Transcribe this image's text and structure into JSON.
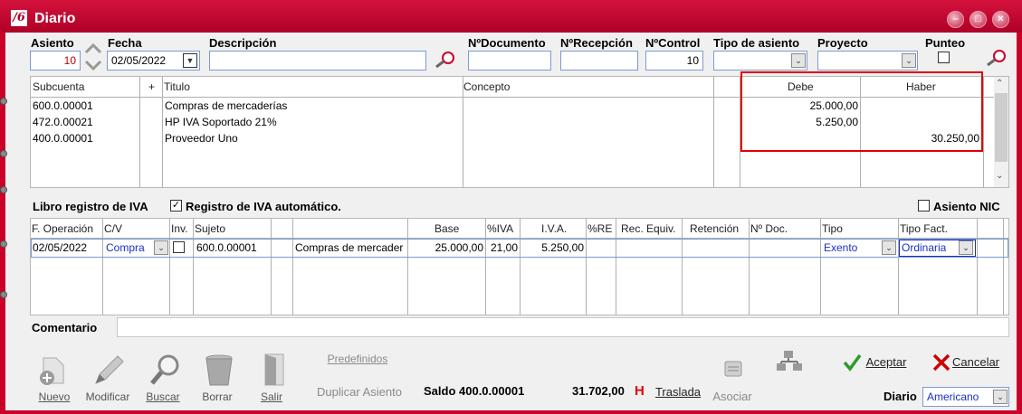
{
  "window": {
    "title": "Diario",
    "logo": "/6"
  },
  "header": {
    "asiento_label": "Asiento",
    "asiento_value": "10",
    "fecha_label": "Fecha",
    "fecha_value": "02/05/2022",
    "descripcion_label": "Descripción",
    "descripcion_value": "",
    "ndocumento_label": "NºDocumento",
    "ndocumento_value": "",
    "nrecepcion_label": "NºRecepción",
    "nrecepcion_value": "",
    "ncontrol_label": "NºControl",
    "ncontrol_value": "10",
    "tipo_asiento_label": "Tipo de asiento",
    "tipo_asiento_value": "",
    "proyecto_label": "Proyecto",
    "proyecto_value": "",
    "punteo_label": "Punteo"
  },
  "entries": {
    "columns": {
      "subcuenta": "Subcuenta",
      "plus": "+",
      "titulo": "Titulo",
      "concepto": "Concepto",
      "debe": "Debe",
      "haber": "Haber"
    },
    "rows": [
      {
        "subcuenta": "600.0.00001",
        "titulo": "Compras de mercaderías",
        "concepto": "",
        "debe": "25.000,00",
        "haber": ""
      },
      {
        "subcuenta": "472.0.00021",
        "titulo": "HP IVA Soportado 21%",
        "concepto": "",
        "debe": "5.250,00",
        "haber": ""
      },
      {
        "subcuenta": "400.0.00001",
        "titulo": "Proveedor Uno",
        "concepto": "",
        "debe": "",
        "haber": "30.250,00"
      }
    ]
  },
  "iva": {
    "libro_label": "Libro registro de IVA",
    "auto_label": "Registro de IVA automático.",
    "auto_checked": true,
    "nic_label": "Asiento NIC",
    "nic_checked": false,
    "columns": {
      "f_operacion": "F. Operación",
      "cv": "C/V",
      "inv": "Inv.",
      "sujeto": "Sujeto",
      "base": "Base",
      "piva": "%IVA",
      "iva": "I.V.A.",
      "pre": "%RE",
      "rec_equiv": "Rec. Equiv.",
      "retencion": "Retención",
      "n_doc": "Nº Doc.",
      "tipo": "Tipo",
      "tipo_fact": "Tipo Fact."
    },
    "row": {
      "f_operacion": "02/05/2022",
      "cv": "Compra",
      "sujeto": "600.0.00001",
      "desc": "Compras de mercader",
      "base": "25.000,00",
      "piva": "21,00",
      "iva": "5.250,00",
      "tipo": "Exento",
      "tipo_fact": "Ordinaria"
    }
  },
  "comentario_label": "Comentario",
  "toolbar": {
    "nuevo": "Nuevo",
    "modificar": "Modificar",
    "buscar": "Buscar",
    "borrar": "Borrar",
    "salir": "Salir",
    "predefinidos": "Predefinidos",
    "duplicar": "Duplicar Asiento",
    "asociar": "Asociar",
    "aceptar": "Aceptar",
    "cancelar": "Cancelar"
  },
  "status": {
    "saldo_label": "Saldo 400.0.00001",
    "saldo_value": "31.702,00",
    "saldo_flag": "H",
    "traslada": "Traslada",
    "diario_label": "Diario",
    "diario_value": "Americano"
  },
  "colors": {
    "brand": "#c8002a",
    "highlight_border": "#e00000",
    "field_border": "#7a9bd4",
    "ok_green": "#2a9a2a",
    "cancel_red": "#d00000"
  }
}
